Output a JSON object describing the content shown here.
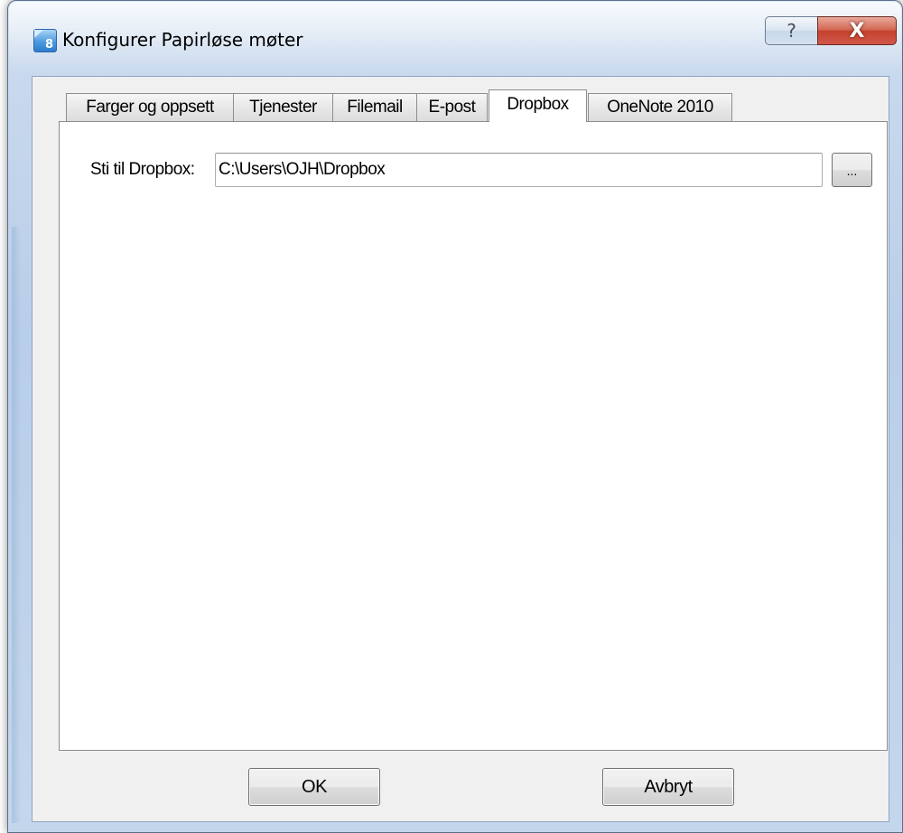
{
  "window": {
    "title": "Konfigurer Papirløse møter",
    "app_icon_digit": "8",
    "help_glyph": "?",
    "close_glyph": "X"
  },
  "tabs": [
    {
      "label": "Farger og oppsett",
      "active": false
    },
    {
      "label": "Tjenester",
      "active": false
    },
    {
      "label": "Filemail",
      "active": false
    },
    {
      "label": "E-post",
      "active": false
    },
    {
      "label": "Dropbox",
      "active": true
    },
    {
      "label": "OneNote 2010",
      "active": false
    }
  ],
  "dropbox": {
    "path_label": "Sti til Dropbox:",
    "path_value": "C:\\Users\\OJH\\Dropbox",
    "browse_label": "..."
  },
  "buttons": {
    "ok": "OK",
    "cancel": "Avbryt"
  }
}
